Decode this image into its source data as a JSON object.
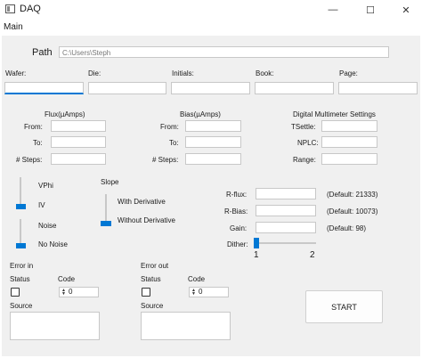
{
  "window": {
    "title": "DAQ",
    "minimize": "—",
    "maximize": "☐",
    "close": "✕"
  },
  "menu": {
    "main": "Main"
  },
  "path": {
    "label": "Path",
    "value": "C:\\Users\\Steph"
  },
  "header_fields": [
    {
      "label": "Wafer:",
      "value": ""
    },
    {
      "label": "Die:",
      "value": ""
    },
    {
      "label": "Initials:",
      "value": ""
    },
    {
      "label": "Book:",
      "value": ""
    },
    {
      "label": "Page:",
      "value": ""
    }
  ],
  "flux": {
    "title": "Flux(µAmps)",
    "from": "From:",
    "to": "To:",
    "steps": "# Steps:"
  },
  "bias": {
    "title": "Bias(µAmps)",
    "from": "From:",
    "to": "To:",
    "steps": "# Steps:"
  },
  "dmm": {
    "title": "Digital Multimeter Settings",
    "tsettle": "TSettle:",
    "nplc": "NPLC:",
    "range": "Range:"
  },
  "mode_slider": {
    "top": "VPhi",
    "bottom": "IV",
    "selected": "IV"
  },
  "noise_slider": {
    "top": "Noise",
    "bottom": "No Noise",
    "selected": "No Noise"
  },
  "slope": {
    "title": "Slope",
    "top": "With Derivative",
    "bottom": "Without Derivative",
    "selected": "Without Derivative"
  },
  "params": {
    "rflux": {
      "label": "R-flux:",
      "default": "(Default: 21333)"
    },
    "rbias": {
      "label": "R-Bias:",
      "default": "(Default: 10073)"
    },
    "gain": {
      "label": "Gain:",
      "default": "(Default: 98)"
    }
  },
  "dither": {
    "label": "Dither:",
    "min": "1",
    "max": "2",
    "value": 1
  },
  "error_in": {
    "title": "Error in",
    "status": "Status",
    "code": "Code",
    "code_value": "0",
    "source": "Source"
  },
  "error_out": {
    "title": "Error out",
    "status": "Status",
    "code": "Code",
    "code_value": "0",
    "source": "Source"
  },
  "start_button": "START"
}
